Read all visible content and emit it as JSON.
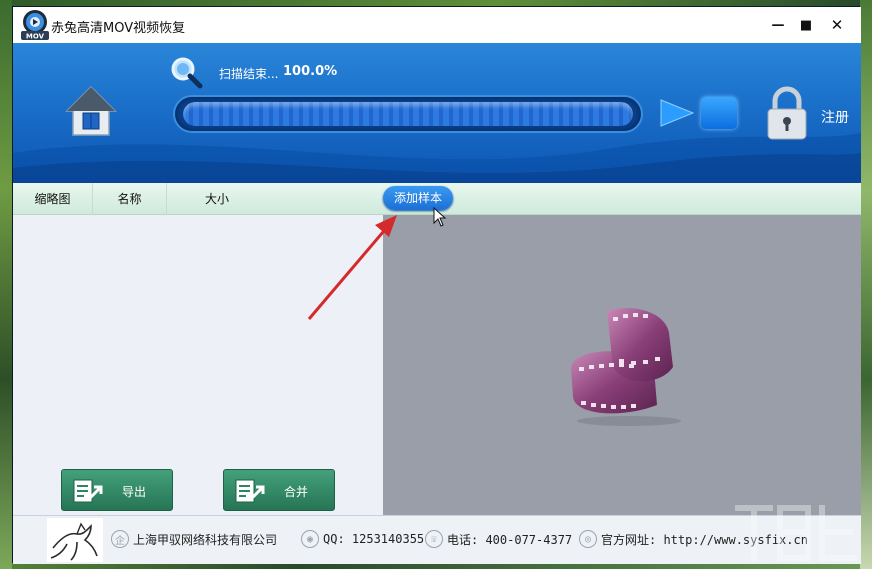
{
  "window": {
    "title": "赤兔高清MOV视频恢复",
    "logo_text": "MOV",
    "controls": {
      "minimize": "—",
      "maximize": "■",
      "close": "✕"
    }
  },
  "header": {
    "scan_status": "扫描结束...",
    "scan_percent": "100.0%",
    "progress": 1.0,
    "register_label": "注册"
  },
  "columns": {
    "thumbnail": "缩略图",
    "name": "名称",
    "size": "大小",
    "add_sample": "添加样本"
  },
  "buttons": {
    "export": "导出",
    "merge": "合并"
  },
  "footer": {
    "company": "上海甲驭网络科技有限公司",
    "qq": "QQ: 1253140355",
    "phone": "电话: 400-077-4377",
    "website": "官方网址: http://www.sysfix.cn"
  },
  "colors": {
    "header_blue": "#1a6fc9",
    "button_green": "#2f8563",
    "pill_blue": "#2a86e6",
    "arrow_red": "#d42a2a"
  }
}
